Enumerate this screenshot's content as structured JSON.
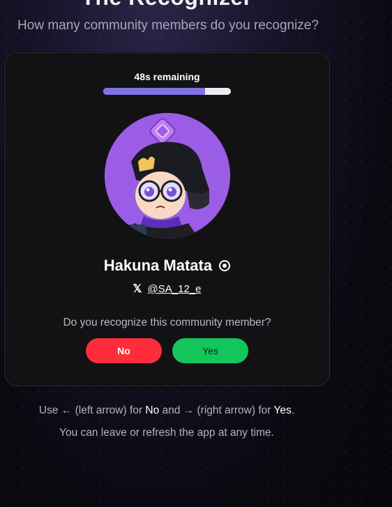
{
  "page": {
    "title": "The Recognizer",
    "subtitle": "How many community members do you recognize?"
  },
  "card": {
    "timer_text": "48s remaining",
    "progress_fraction": 0.8,
    "member_name": "Hakuna Matata",
    "name_icon": "target-icon",
    "social_icon": "x-logo-icon",
    "social_handle": "@SA_12_e",
    "question": "Do you recognize this community member?",
    "no_label": "No",
    "yes_label": "Yes"
  },
  "hints": {
    "line1_prefix": "Use ← (left arrow) for",
    "line1_no": "No",
    "line1_mid": "and → (right arrow) for",
    "line1_yes": "Yes",
    "line1_suffix": ".",
    "line2": "You can leave or refresh the app at any time."
  },
  "colors": {
    "accent_progress": "#7f72e6",
    "no_button": "#ff2d3a",
    "yes_button": "#13c55a",
    "avatar_bg": "#9b5de5"
  }
}
